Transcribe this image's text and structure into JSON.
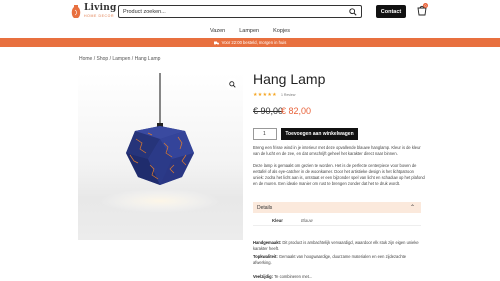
{
  "header": {
    "logo_word": "Living",
    "logo_sub": "HOME DECOR",
    "search_value": "Product zoeken...",
    "contact_label": "Contact",
    "cart_count": "0"
  },
  "nav": {
    "items": [
      "Vazen",
      "Lampen",
      "Kopjes"
    ]
  },
  "promo": {
    "text": "Voor 22:00 besteld, morgen in huis"
  },
  "breadcrumb": "Home / Shop / Lampen / Hang Lamp",
  "product": {
    "title": "Hang Lamp",
    "stars": "★★★★★",
    "review_count": "1 Review",
    "price_old": "€ 90,00",
    "price_new": "€ 82,00",
    "quantity": "1",
    "add_to_cart_label": "Toevoegen aan winkelwagen",
    "description_1": "Breng een frisse wind in je interieur met deze opvallende blauwe hanglamp. Kleur is de kleur van de lucht en de zee, en dat omschrijft geheel het karakter direct naar binnen.",
    "description_2": "Deze lamp is gemaakt om gezien te worden. Het is de perfecte centerpiece voor boven de eettafel of als eye-catcher in de woonkamer. Door het artistieke design is het lichtpatroon uniek: zodra het licht aan is, ontstaat er een bijzonder spel van licht en schaduw op het plafond en de muren. Een ideale manier om rust te brengen zonder dat het te druk wordt.",
    "tab_label": "Details",
    "attr_key": "Kleur",
    "attr_value": "Blauw",
    "feature_1_title": "Handgemaakt:",
    "feature_1_text": "Dit product is ambachtelijk vervaardigd, waardoor elk stuk zijn eigen unieke karakter heeft.",
    "feature_2_title": "Topkwaliteit:",
    "feature_2_text": "Gemaakt van hoogwaardige, duurzame materialen en een zijdezachte afwerking.",
    "feature_3_title": "Veelzijdig:",
    "feature_3_text": "Te combineren met..."
  },
  "colors": {
    "accent": "#e8703f",
    "price": "#e8623a",
    "lamp_blue": "#2f3e8f",
    "lamp_crack": "#e07b2c"
  },
  "icons": {
    "search": "search-icon",
    "cart": "cart-icon",
    "zoom": "zoom-icon",
    "truck": "truck-icon"
  }
}
